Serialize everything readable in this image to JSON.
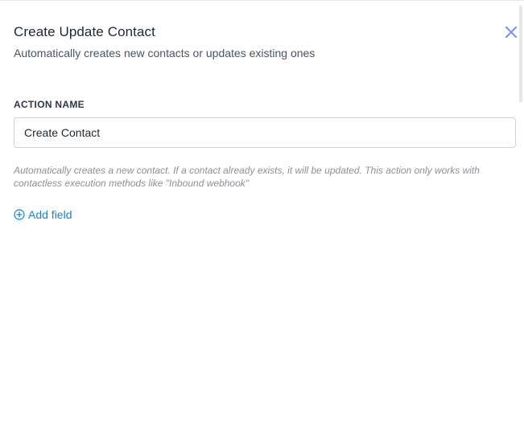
{
  "dialog": {
    "title": "Create Update Contact",
    "subtitle": "Automatically creates new contacts or updates existing ones",
    "close_icon": "close-icon"
  },
  "action_name": {
    "label": "ACTION NAME",
    "value": "Create Contact",
    "help_text": "Automatically creates a new contact. If a contact already exists, it will be updated. This action only works with contactless execution methods like \"Inbound webhook\""
  },
  "add_field": {
    "label": "Add field",
    "icon": "plus-circle-icon"
  },
  "colors": {
    "accent": "#1f7fb8",
    "close_icon": "#7b8ee8"
  }
}
